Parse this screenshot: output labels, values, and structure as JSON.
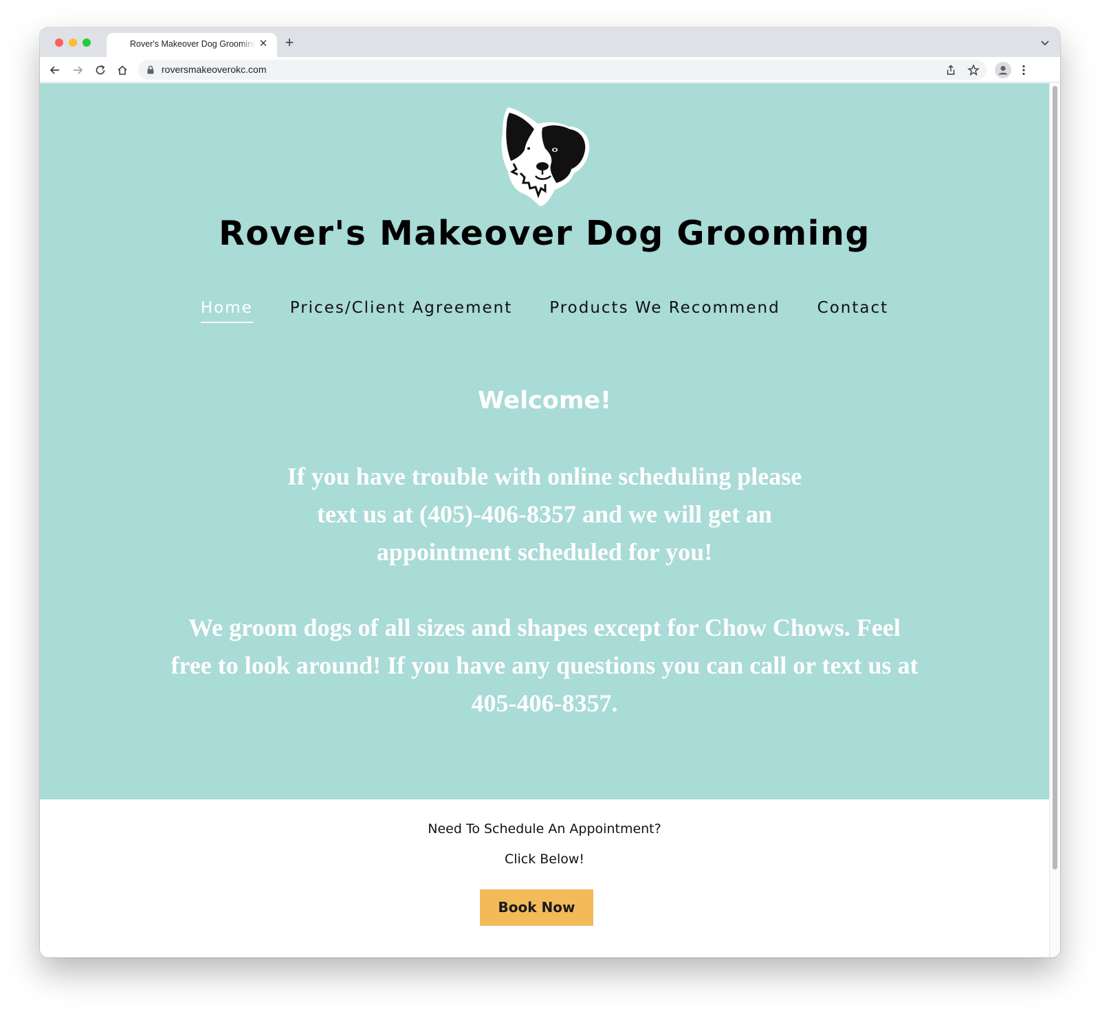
{
  "browser": {
    "tab_title": "Rover's Makeover Dog Grooming",
    "tab_close": "✕",
    "new_tab": "+",
    "url": "roversmakeoverokc.com"
  },
  "site": {
    "title": "Rover's Makeover Dog Grooming",
    "nav": [
      {
        "label": "Home",
        "active": true
      },
      {
        "label": "Prices/Client Agreement",
        "active": false
      },
      {
        "label": "Products We Recommend",
        "active": false
      },
      {
        "label": "Contact",
        "active": false
      }
    ],
    "welcome": "Welcome!",
    "paragraph1": "If you have trouble with online scheduling please text us at (405)-406-8357 and we will get an appointment scheduled for you!",
    "paragraph2": "We groom dogs of all sizes and shapes except for Chow Chows. Feel free to look around! If you have any questions you can call or text us at 405-406-8357."
  },
  "cta": {
    "question": "Need To Schedule An Appointment?",
    "click_below": "Click Below!",
    "book_button": "Book Now"
  },
  "colors": {
    "hero_bg": "#a9dbd7",
    "button_bg": "#f2ba59",
    "nav_active": "#ffffff"
  }
}
